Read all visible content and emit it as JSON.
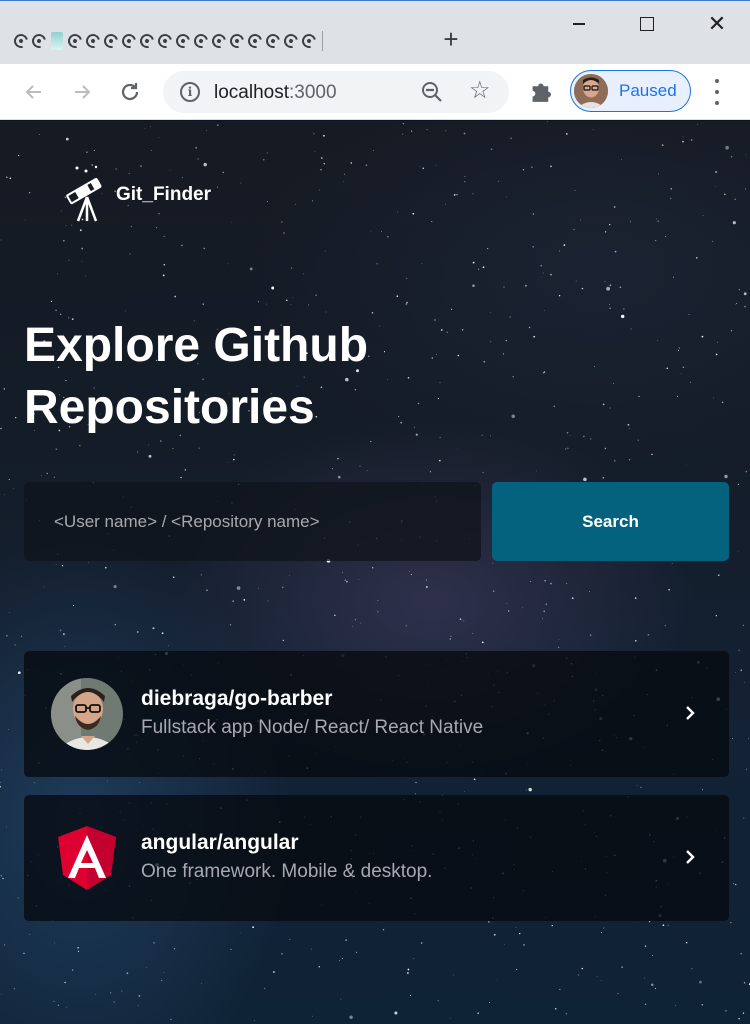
{
  "browser": {
    "tab_count": 17,
    "active_tab_index": 3,
    "new_tab_label": "+",
    "window": {
      "minimize": "minimize-icon",
      "maximize": "maximize-icon",
      "close_label": "✕"
    },
    "url_host": "localhost",
    "url_port": ":3000",
    "profile_status": "Paused",
    "accent_color": "#1a73e8"
  },
  "app": {
    "logo_text": "Git_Finder",
    "headline_line1": "Explore Github",
    "headline_line2": "Repositories",
    "search": {
      "placeholder": "<User name> / <Repository name>",
      "value": "",
      "button_label": "Search",
      "button_color": "#04627f"
    },
    "repositories": [
      {
        "full_name": "diebraga/go-barber",
        "description": "Fullstack app Node/ React/ React Native",
        "avatar": "user-photo"
      },
      {
        "full_name": "angular/angular",
        "description": "One framework. Mobile & desktop.",
        "avatar": "angular-logo"
      }
    ]
  }
}
